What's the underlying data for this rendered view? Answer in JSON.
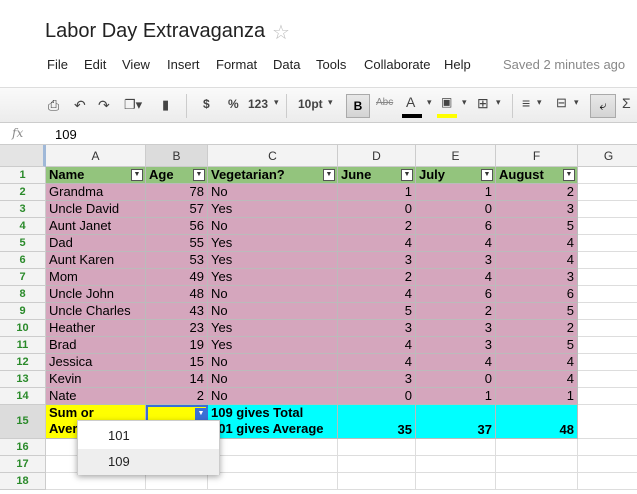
{
  "doc": {
    "title": "Labor Day Extravaganza",
    "saved_status": "Saved 2 minutes ago"
  },
  "menu": [
    "File",
    "Edit",
    "View",
    "Insert",
    "Format",
    "Data",
    "Tools",
    "Collaborate",
    "Help"
  ],
  "toolbar": {
    "currency": "$",
    "percent": "%",
    "number_format": "123",
    "font_size": "10pt",
    "bold": "B",
    "strike": "Abc",
    "text_color_glyph": "A",
    "sigma": "Σ",
    "text_color": "#000000",
    "fill_color": "#ffff00"
  },
  "formula": {
    "fx": "fx",
    "value": "109"
  },
  "columns": [
    "A",
    "B",
    "C",
    "D",
    "E",
    "F",
    "G"
  ],
  "rows": [
    "1",
    "2",
    "3",
    "4",
    "5",
    "6",
    "7",
    "8",
    "9",
    "10",
    "11",
    "12",
    "13",
    "14",
    "15",
    "16",
    "17",
    "18"
  ],
  "header_row": [
    "Name",
    "Age",
    "Vegetarian?",
    "June",
    "July",
    "August"
  ],
  "table": [
    [
      "Grandma",
      "78",
      "No",
      "1",
      "1",
      "2"
    ],
    [
      "Uncle David",
      "57",
      "Yes",
      "0",
      "0",
      "3"
    ],
    [
      "Aunt Janet",
      "56",
      "No",
      "2",
      "6",
      "5"
    ],
    [
      "Dad",
      "55",
      "Yes",
      "4",
      "4",
      "4"
    ],
    [
      "Aunt Karen",
      "53",
      "Yes",
      "3",
      "3",
      "4"
    ],
    [
      "Mom",
      "49",
      "Yes",
      "2",
      "4",
      "3"
    ],
    [
      "Uncle John",
      "48",
      "No",
      "4",
      "6",
      "6"
    ],
    [
      "Uncle Charles",
      "43",
      "No",
      "5",
      "2",
      "5"
    ],
    [
      "Heather",
      "23",
      "Yes",
      "3",
      "3",
      "2"
    ],
    [
      "Brad",
      "19",
      "Yes",
      "4",
      "3",
      "5"
    ],
    [
      "Jessica",
      "15",
      "No",
      "4",
      "4",
      "4"
    ],
    [
      "Kevin",
      "14",
      "No",
      "3",
      "0",
      "4"
    ],
    [
      "Nate",
      "2",
      "No",
      "0",
      "1",
      "1"
    ]
  ],
  "row15": {
    "a_line1": "Sum or",
    "a_line2": "Aver",
    "c_line1": "109 gives Total",
    "c_line2": "101 gives Average",
    "d": "35",
    "e": "37",
    "f": "48"
  },
  "dropdown": {
    "options": [
      "101",
      "109"
    ],
    "highlighted": "109"
  }
}
